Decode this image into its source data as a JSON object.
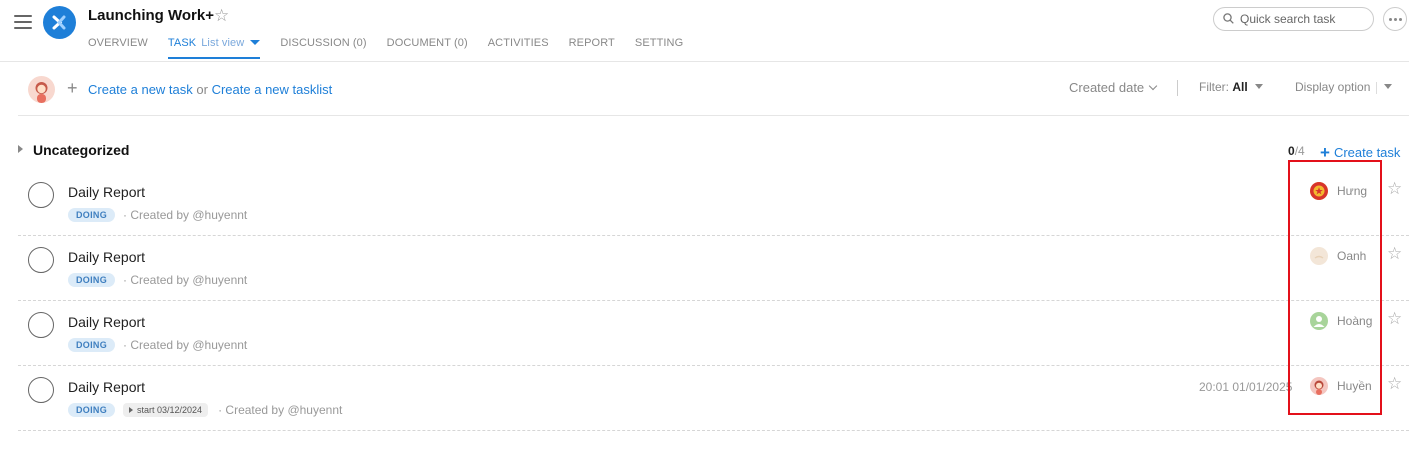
{
  "header": {
    "title": "Launching Work+",
    "tabs": [
      {
        "label": "OVERVIEW"
      },
      {
        "label": "TASK",
        "sub": "List view"
      },
      {
        "label": "DISCUSSION (0)"
      },
      {
        "label": "DOCUMENT (0)"
      },
      {
        "label": "ACTIVITIES"
      },
      {
        "label": "REPORT"
      },
      {
        "label": "SETTING"
      }
    ],
    "search_placeholder": "Quick search task"
  },
  "toolbar": {
    "create_task": "Create a new task",
    "or": "or",
    "create_tasklist": "Create a new tasklist",
    "sort_label": "Created date",
    "filter_label": "Filter:",
    "filter_value": "All",
    "display_label": "Display option"
  },
  "group": {
    "title": "Uncategorized",
    "done": "0",
    "total": "/4",
    "create_label": "Create task"
  },
  "tasks": [
    {
      "name": "Daily Report",
      "status": "DOING",
      "created": "· Created by @huyennt",
      "assignee": "Hưng",
      "avatar_color": "#e8a33a"
    },
    {
      "name": "Daily Report",
      "status": "DOING",
      "created": "· Created by @huyennt",
      "assignee": "Oanh",
      "avatar_color": "#f3e6d8"
    },
    {
      "name": "Daily Report",
      "status": "DOING",
      "created": "· Created by @huyennt",
      "assignee": "Hoàng",
      "avatar_color": "#a8d49a"
    },
    {
      "name": "Daily Report",
      "status": "DOING",
      "start": "start 03/12/2024",
      "created": "· Created by @huyennt",
      "due": "20:01 01/01/2025",
      "assignee": "Huyền",
      "avatar_color": "#f4c6c0"
    }
  ],
  "colors": {
    "accent": "#1e7fd8",
    "highlight": "#e3101a",
    "badge_bg": "#dcebf8"
  }
}
